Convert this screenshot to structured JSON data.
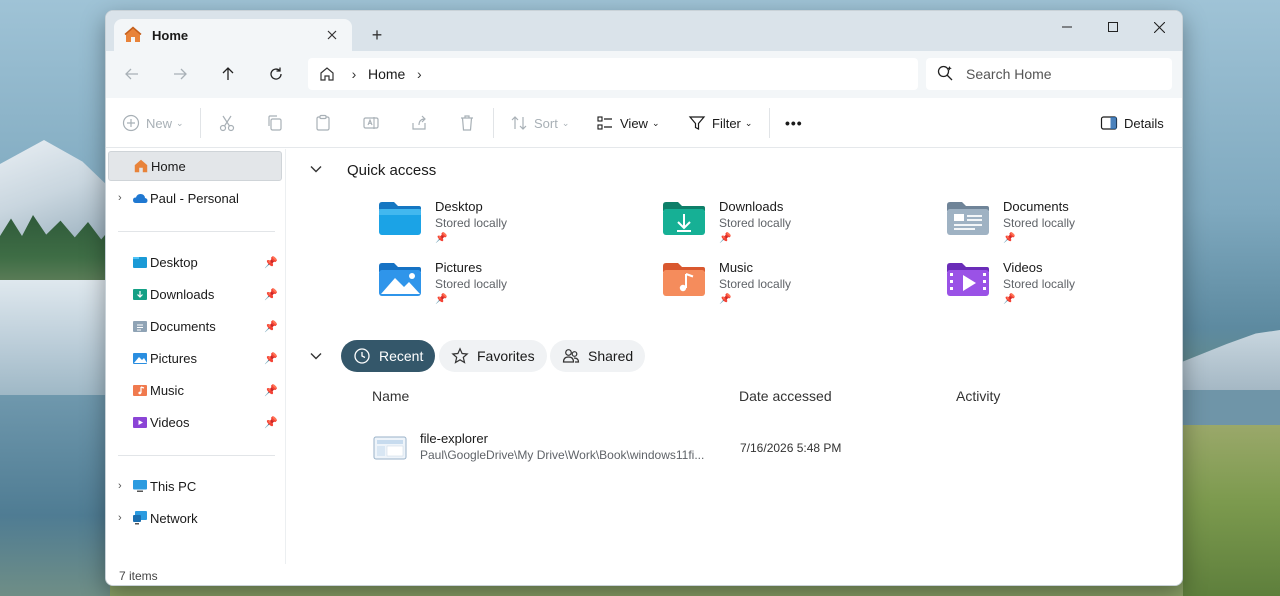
{
  "window": {
    "tab_title": "Home",
    "new_tab_symbol": "+",
    "controls": [
      "minimize",
      "maximize",
      "close"
    ]
  },
  "navigation": {
    "back": "back-arrow",
    "forward": "forward-arrow",
    "up": "up-arrow",
    "refresh": "refresh",
    "breadcrumb": [
      "Home"
    ],
    "search_placeholder": "Search Home"
  },
  "toolbar": {
    "new_label": "New",
    "sort_label": "Sort",
    "view_label": "View",
    "filter_label": "Filter",
    "more_label": "•••",
    "details_label": "Details"
  },
  "sidebar": {
    "top_items": [
      {
        "label": "Home",
        "icon": "home-icon",
        "selected": true
      },
      {
        "label": "Paul - Personal",
        "icon": "cloud-icon"
      }
    ],
    "pinned_items": [
      {
        "label": "Desktop",
        "icon": "desktop-folder-icon"
      },
      {
        "label": "Downloads",
        "icon": "downloads-folder-icon"
      },
      {
        "label": "Documents",
        "icon": "documents-folder-icon"
      },
      {
        "label": "Pictures",
        "icon": "pictures-folder-icon"
      },
      {
        "label": "Music",
        "icon": "music-folder-icon"
      },
      {
        "label": "Videos",
        "icon": "videos-folder-icon"
      }
    ],
    "bottom_items": [
      {
        "label": "This PC",
        "icon": "pc-icon"
      },
      {
        "label": "Network",
        "icon": "network-icon"
      }
    ]
  },
  "main": {
    "quick_access_title": "Quick access",
    "quick_access": [
      {
        "name": "Desktop",
        "sub": "Stored locally",
        "icon": "desktop-folder-icon"
      },
      {
        "name": "Downloads",
        "sub": "Stored locally",
        "icon": "downloads-folder-icon"
      },
      {
        "name": "Documents",
        "sub": "Stored locally",
        "icon": "documents-folder-icon"
      },
      {
        "name": "Pictures",
        "sub": "Stored locally",
        "icon": "pictures-folder-icon"
      },
      {
        "name": "Music",
        "sub": "Stored locally",
        "icon": "music-folder-icon"
      },
      {
        "name": "Videos",
        "sub": "Stored locally",
        "icon": "videos-folder-icon"
      }
    ],
    "tabs": {
      "recent": "Recent",
      "favorites": "Favorites",
      "shared": "Shared"
    },
    "columns": {
      "name": "Name",
      "date": "Date accessed",
      "activity": "Activity"
    },
    "recent_files": [
      {
        "name": "file-explorer",
        "path": "Paul\\GoogleDrive\\My Drive\\Work\\Book\\windows11fi...",
        "date": "7/16/2026 5:48 PM"
      }
    ]
  },
  "status": {
    "item_count": "7 items"
  },
  "colors": {
    "accent_pill": "#34576a",
    "titlebar": "#dae3ea",
    "chrome": "#f3f6f8"
  }
}
